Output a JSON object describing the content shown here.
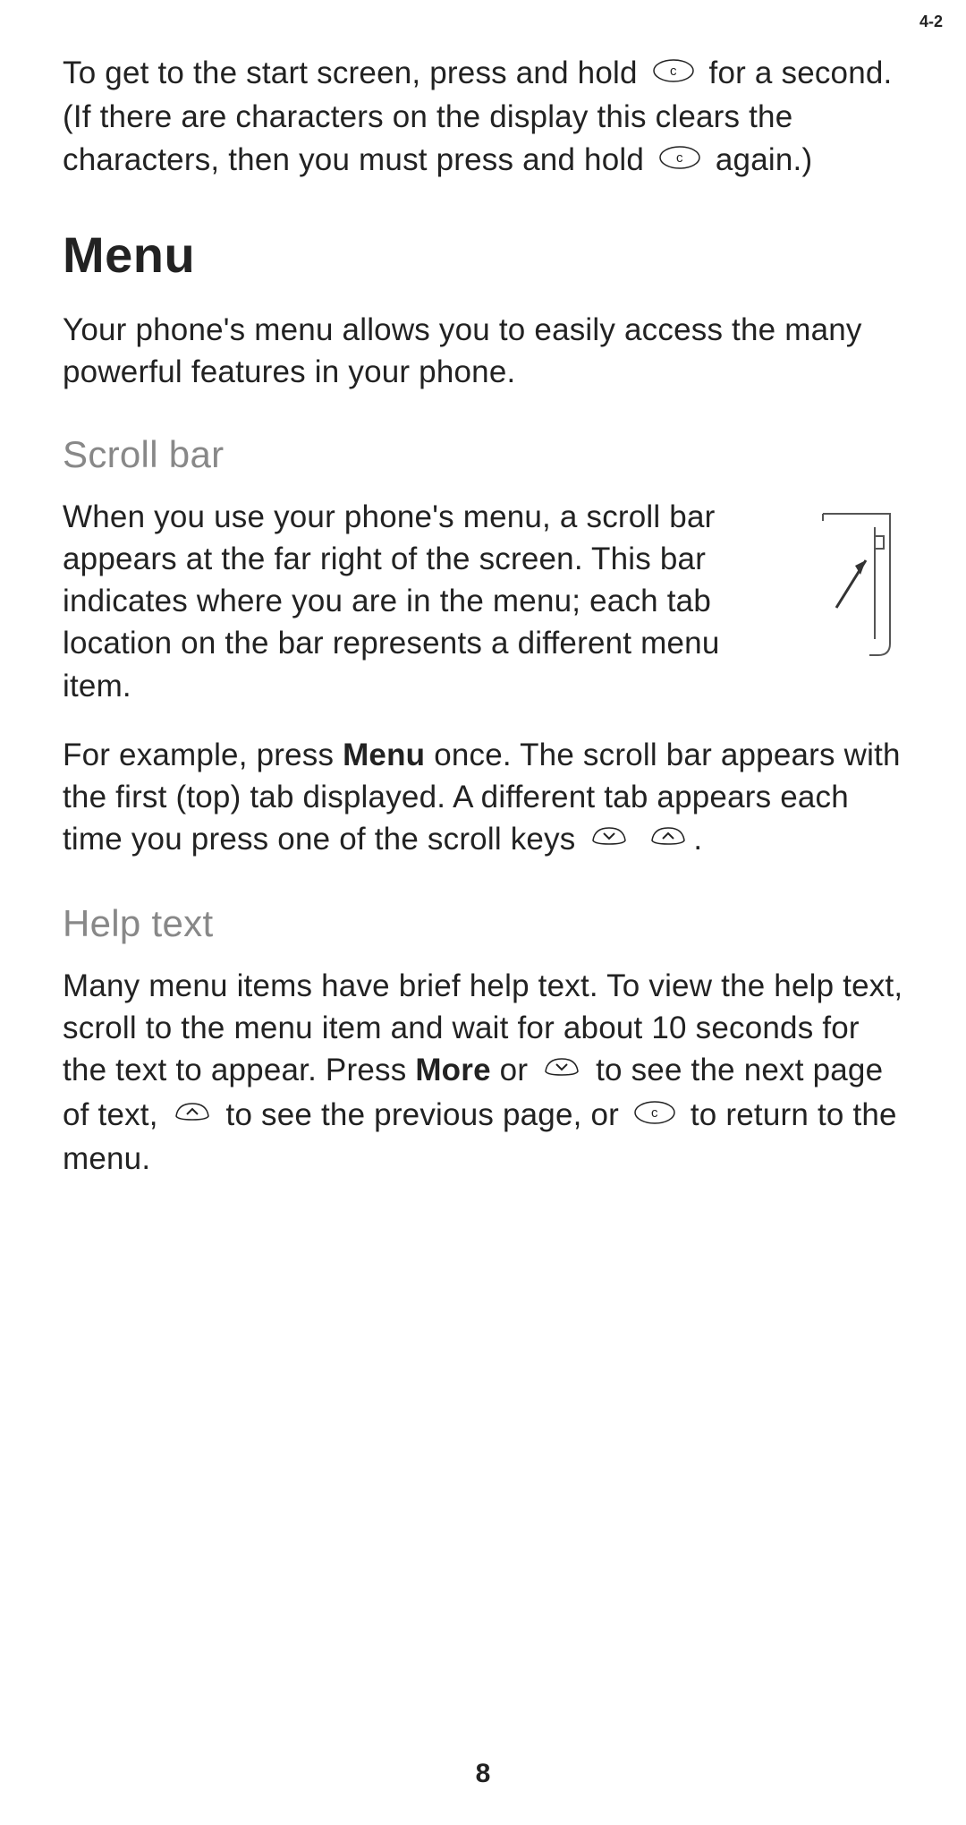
{
  "intro": {
    "p1a": "To get to the start screen, press and hold ",
    "p1b": " for a second. (If there are characters on the display this clears the characters, then you must press and hold ",
    "p1c": " again.)"
  },
  "menu": {
    "heading": "Menu",
    "p1": "Your phone's menu allows you to easily access the many powerful features in your phone."
  },
  "scrollbar": {
    "heading": "Scroll bar",
    "p1": "When you use your phone's menu, a scroll bar appears at the far right of the screen. This bar indicates where you are in the menu; each tab location on the bar represents a different menu item.",
    "p2a": "For example, press ",
    "bold_menu": "Menu",
    "p2b": " once. The scroll bar appears with the first (top) tab displayed. A different tab appears each time you press one of the scroll keys ",
    "p2c": ".",
    "figure_label": "4-2"
  },
  "helptext": {
    "heading": "Help text",
    "p1a": "Many menu items have brief help text. To view the help text, scroll to the menu item and wait for about 10 seconds for the text to appear. Press ",
    "bold_more": "More",
    "p1b": " or ",
    "p1c": " to see the next page of text, ",
    "p1d": " to see the previous page, or ",
    "p1e": " to return to the menu."
  },
  "page_number": "8"
}
